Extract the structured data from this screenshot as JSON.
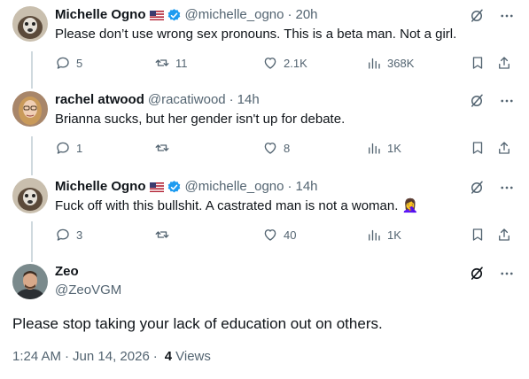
{
  "replies": [
    {
      "name": "Michelle Ogno",
      "flag_icon": "us-flag-icon",
      "verified": true,
      "handle": "@michelle_ogno",
      "time": "20h",
      "text": "Please don’t use wrong sex pronouns. This is a beta man. Not a girl.",
      "replies_count": "5",
      "reposts_count": "11",
      "likes_count": "2.1K",
      "views_count": "368K"
    },
    {
      "name": "rachel atwood",
      "verified": false,
      "handle": "@racatiwood",
      "time": "14h",
      "text": "Brianna sucks, but her gender isn't up for debate.",
      "replies_count": "1",
      "reposts_count": "",
      "likes_count": "8",
      "views_count": "1K"
    },
    {
      "name": "Michelle Ogno",
      "flag_icon": "us-flag-icon",
      "verified": true,
      "handle": "@michelle_ogno",
      "time": "14h",
      "text": "Fuck off with this bullshit. A castrated man is not a woman. 🤦‍♀️",
      "replies_count": "3",
      "reposts_count": "",
      "likes_count": "40",
      "views_count": "1K"
    }
  ],
  "main_post": {
    "name": "Zeo",
    "handle": "@ZeoVGM",
    "text": "Please stop taking your lack of education out on others.",
    "time": "1:24 AM",
    "date": "Jun 14, 2026",
    "views_count": "4",
    "views_label": "Views"
  },
  "colors": {
    "text": "#0f1419",
    "secondary": "#536471",
    "verified": "#1d9bf0",
    "thread_line": "#cfd9de"
  }
}
